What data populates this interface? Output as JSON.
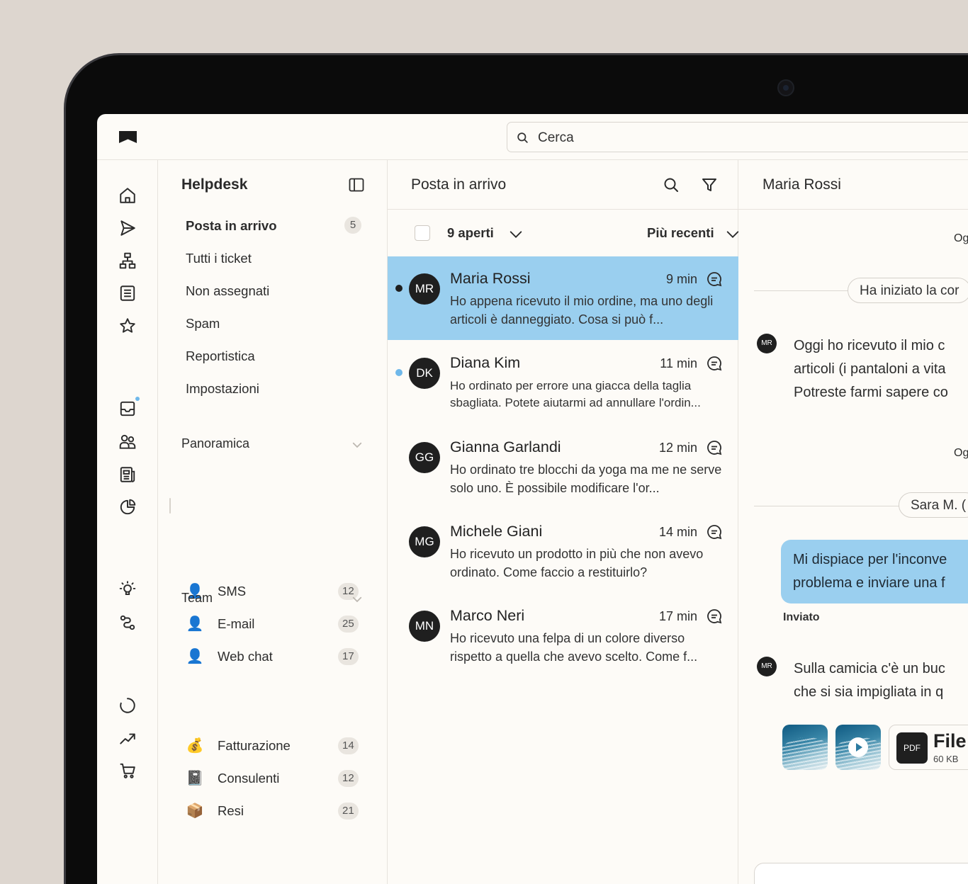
{
  "topbar": {
    "search_placeholder": "Cerca"
  },
  "rail": {
    "icons": [
      "home-icon",
      "send-icon",
      "org-chart-icon",
      "list-icon",
      "star-icon",
      "inbox-icon",
      "contacts-icon",
      "news-icon",
      "pie-chart-icon",
      "lightbulb-icon",
      "workflow-icon",
      "loading-icon",
      "trend-icon",
      "cart-icon"
    ]
  },
  "helpdesk": {
    "title": "Helpdesk",
    "nav": [
      {
        "label": "Posta in arrivo",
        "badge": "5"
      },
      {
        "label": "Tutti i ticket"
      },
      {
        "label": "Non assegnati"
      },
      {
        "label": "Spam"
      },
      {
        "label": "Reportistica"
      },
      {
        "label": "Impostazioni"
      }
    ],
    "overview": {
      "title": "Panoramica",
      "items": [
        {
          "emoji": "👤",
          "label": "SMS",
          "count": "12"
        },
        {
          "emoji": "👤",
          "label": "E-mail",
          "count": "25"
        },
        {
          "emoji": "👤",
          "label": "Web chat",
          "count": "17"
        }
      ]
    },
    "team": {
      "title": "Team",
      "items": [
        {
          "emoji": "💰",
          "label": "Fatturazione",
          "count": "14"
        },
        {
          "emoji": "📓",
          "label": "Consulenti",
          "count": "12"
        },
        {
          "emoji": "📦",
          "label": "Resi",
          "count": "21"
        }
      ]
    }
  },
  "inbox": {
    "title": "Posta in arrivo",
    "filter": {
      "open": "9 aperti",
      "sort": "Più recenti"
    },
    "conversations": [
      {
        "initials": "MR",
        "name": "Maria Rossi",
        "time": "9 min",
        "preview": "Ho appena ricevuto il mio ordine, ma uno degli articoli è danneggiato. Cosa si può f...",
        "unread": true,
        "selected": true
      },
      {
        "initials": "DK",
        "name": "Diana Kim",
        "time": "11 min",
        "preview": "Ho ordinato per errore una giacca della taglia sbagliata. Potete aiutarmi ad annullare l'ordin...",
        "unread": true,
        "selected": false
      },
      {
        "initials": "GG",
        "name": "Gianna Garlandi",
        "time": "12 min",
        "preview": "Ho ordinato tre blocchi da yoga ma me ne serve solo uno. È possibile modificare l'or...",
        "unread": false,
        "selected": false
      },
      {
        "initials": "MG",
        "name": "Michele Giani",
        "time": "14 min",
        "preview": "Ho ricevuto un prodotto in più che non avevo ordinato. Come faccio a restituirlo?",
        "unread": false,
        "selected": false
      },
      {
        "initials": "MN",
        "name": "Marco Neri",
        "time": "17 min",
        "preview": "Ho ricevuto una felpa di un colore diverso rispetto a quella che avevo scelto. Come f...",
        "unread": false,
        "selected": false
      }
    ]
  },
  "detail": {
    "name": "Maria Rossi",
    "clip1": "Og",
    "pill1": "Ha iniziato la cor",
    "avatar1": "MR",
    "message1": [
      "Oggi ho ricevuto il mio c",
      "articoli (i pantaloni a vita",
      "Potreste farmi sapere co"
    ],
    "clip2": "Og",
    "pill2": "Sara M. (",
    "bubble": [
      "Mi dispiace per l'inconve",
      "problema e inviare una f"
    ],
    "sent": "Inviato",
    "avatar2": "MR",
    "message2": [
      "Sulla camicia c'è un buc",
      "che si sia impigliata in q"
    ],
    "file": {
      "badge": "PDF",
      "name": "File",
      "size": "60 KB"
    }
  },
  "colors": {
    "selected_row": "#9acfef",
    "unread_dot_selected": "#1f1f1f",
    "unread_dot": "#6fb8ea",
    "background": "#fdfbf7"
  }
}
